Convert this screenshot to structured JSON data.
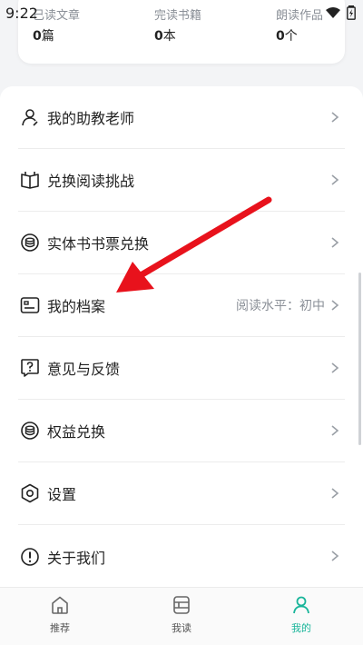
{
  "status_bar": {
    "time": "9:22"
  },
  "stats": [
    {
      "label": "已读文章",
      "count": "0",
      "unit": "篇"
    },
    {
      "label": "完读书籍",
      "count": "0",
      "unit": "本"
    },
    {
      "label": "朗读作品",
      "count": "0",
      "unit": "个"
    }
  ],
  "menu": {
    "items": [
      {
        "label": "我的助教老师",
        "icon": "person-icon"
      },
      {
        "label": "兑换阅读挑战",
        "icon": "open-book-icon"
      },
      {
        "label": "实体书书票兑换",
        "icon": "coin-stack-icon"
      },
      {
        "label": "我的档案",
        "icon": "id-card-icon",
        "extra": "阅读水平：初中"
      },
      {
        "label": "意见与反馈",
        "icon": "feedback-icon"
      },
      {
        "label": "权益兑换",
        "icon": "coin-stack-icon"
      },
      {
        "label": "设置",
        "icon": "hexagon-settings-icon"
      },
      {
        "label": "关于我们",
        "icon": "info-exclaim-icon"
      }
    ]
  },
  "tabbar": {
    "tabs": [
      {
        "label": "推荐",
        "icon": "home-icon",
        "active": false
      },
      {
        "label": "我读",
        "icon": "bookshelf-icon",
        "active": false
      },
      {
        "label": "我的",
        "icon": "profile-icon",
        "active": true
      }
    ]
  },
  "colors": {
    "accent": "#19b59a",
    "annotation_arrow": "#e8121c"
  }
}
